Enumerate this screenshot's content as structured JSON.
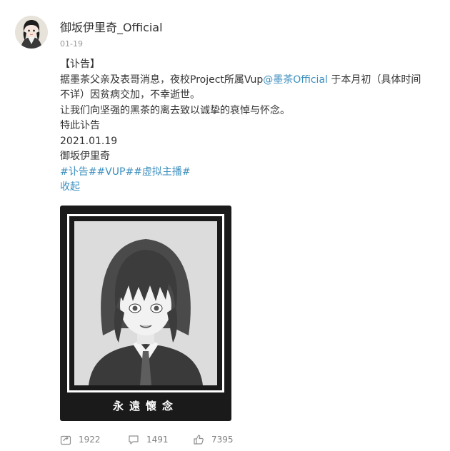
{
  "post": {
    "author": "御坂伊里奇_Official",
    "date": "01-19",
    "tag_title": "【讣告】",
    "line1a": "据墨茶父亲及表哥消息，夜校Project所属Vup",
    "mention": "@墨茶Official",
    "line1b": " 于本月初（具体时间",
    "line2": "不详）因贫病交加，不幸逝世。",
    "line3": "让我们向坚强的黑茶的离去致以诚挚的哀悼与怀念。",
    "line4": "特此讣告",
    "line5": "2021.01.19",
    "line6": "御坂伊里奇",
    "hashtags": "#讣告##VUP##虚拟主播#",
    "collapse": "收起"
  },
  "image": {
    "caption": "永遠懷念"
  },
  "actions": {
    "repost_count": "1922",
    "comment_count": "1491",
    "like_count": "7395"
  },
  "colors": {
    "link": "#3d8fbf",
    "text": "#333333",
    "muted": "#999999",
    "frame": "#1a1a1a"
  }
}
